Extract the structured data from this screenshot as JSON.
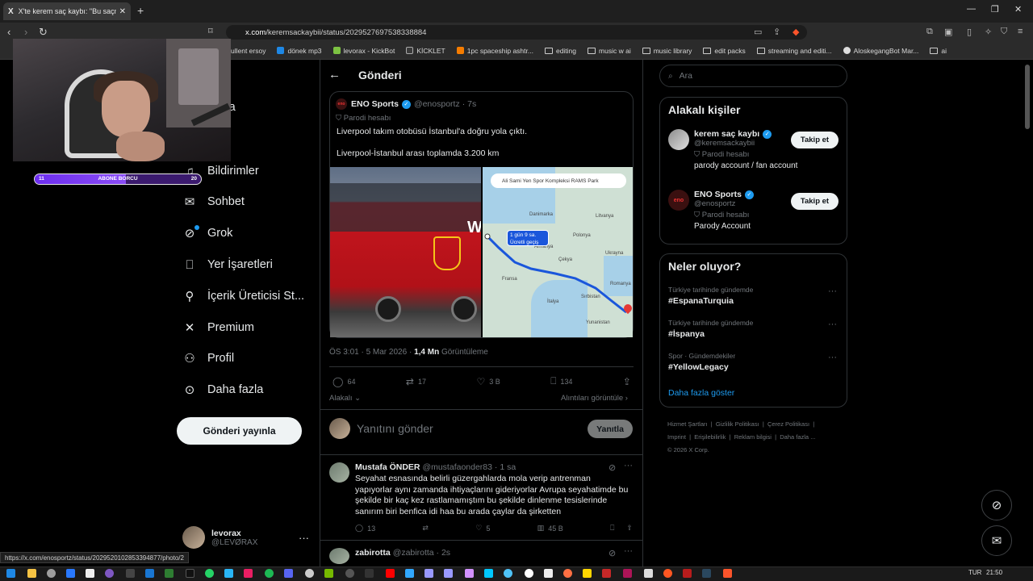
{
  "browser": {
    "tab_title": "X'te kerem saç kaybı: \"Bu saçmal",
    "tab_logo": "X",
    "url_host": "x.com",
    "url_path": "/keremsackaybii/status/2029527697538338884",
    "bookmarks": [
      {
        "label": "ullent ersoy",
        "type": "site"
      },
      {
        "label": "dönek mp3",
        "type": "site"
      },
      {
        "label": "levorax - KickBot",
        "type": "site"
      },
      {
        "label": "KİCKLET",
        "type": "site"
      },
      {
        "label": "1pc spaceship ashtr...",
        "type": "site"
      },
      {
        "label": "editing",
        "type": "folder"
      },
      {
        "label": "music w ai",
        "type": "folder"
      },
      {
        "label": "music library",
        "type": "folder"
      },
      {
        "label": "edit packs",
        "type": "folder"
      },
      {
        "label": "streaming and editi...",
        "type": "folder"
      },
      {
        "label": "AloskegangBot Mar...",
        "type": "site"
      },
      {
        "label": "ai",
        "type": "folder"
      }
    ],
    "status_url": "https://x.com/enosportz/status/2029520102853394877/photo/2"
  },
  "overlay": {
    "sub_label": "ABONE BORCU",
    "sub_current": "11",
    "sub_goal": "20",
    "sub_progress": 0.55
  },
  "nav": {
    "items": [
      {
        "label": "Anasayfa",
        "icon": "home-icon",
        "visible_label": "sayfa"
      },
      {
        "label": "Keşfet",
        "icon": "search-icon",
        "visible_label": "et"
      },
      {
        "label": "Bildirimler",
        "icon": "bell-icon"
      },
      {
        "label": "Sohbet",
        "icon": "chat-icon"
      },
      {
        "label": "Grok",
        "icon": "grok-icon"
      },
      {
        "label": "Yer İşaretleri",
        "icon": "bookmark-icon"
      },
      {
        "label": "İçerik Üreticisi St...",
        "icon": "creator-icon"
      },
      {
        "label": "Premium",
        "icon": "x-premium-icon"
      },
      {
        "label": "Profil",
        "icon": "person-icon"
      },
      {
        "label": "Daha fazla",
        "icon": "more-icon"
      }
    ],
    "post_button": "Gönderi yayınla",
    "account": {
      "name": "levorax",
      "handle": "@LEVØRAX"
    }
  },
  "post": {
    "header_title": "Gönderi",
    "quoted": {
      "name": "ENO Sports",
      "handle": "@enosportz",
      "time": "· 7s",
      "parody_label": "Parodi hesabı",
      "text1": "Liverpool takım otobüsü İstanbul'a doğru yola çıktı.",
      "text2": "Liverpool-İstanbul arası toplamda 3.200 km",
      "map": {
        "search": "Ali Sami Yen Spor Kompleksi RAMS Park",
        "route_label": "1 gün 9 sa.",
        "route_sub": "Ücretli geçiş",
        "labels": [
          "Danimarka",
          "Litvanya",
          "Almanya",
          "Polonya",
          "Fransa",
          "Çekya",
          "Ukrayna",
          "İtalya",
          "Romanya",
          "Sırbistan",
          "Yunanistan"
        ]
      },
      "bus_word": "We"
    },
    "meta_time": "ÖS 3:01 · 5 Mar 2026 · ",
    "meta_views": "1,4 Mn",
    "meta_views_label": " Görüntüleme",
    "stats": {
      "replies": "64",
      "reposts": "17",
      "likes": "3 B",
      "bookmarks": "134"
    },
    "sort_label": "Alakalı",
    "quotes_label": "Alıntıları görüntüle",
    "reply_placeholder": "Yanıtını gönder",
    "reply_button": "Yanıtla"
  },
  "replies": [
    {
      "name": "Mustafa ÖNDER",
      "handle": "@mustafaonder83",
      "time": "· 1 sa",
      "text": "Seyahat esnasında belirli güzergahlarda mola verip antrenman yapıyorlar aynı zamanda ihtiyaçlarını gideriyorlar Avrupa seyahatimde bu şekilde bir kaç kez rastlamamıştım bu şekilde dinlenme tesislerinde sanırım biri benfica idi haa bu arada çaylar da şirketten",
      "replies": "13",
      "likes": "5",
      "views": "45 B"
    },
    {
      "name": "zabirotta",
      "handle": "@zabirotta",
      "time": "· 2s"
    }
  ],
  "sidebar": {
    "search_placeholder": "Ara",
    "people_title": "Alakalı kişiler",
    "people": [
      {
        "name": "kerem saç kaybı",
        "handle": "@keremsackaybii",
        "parody": "Parodi hesabı",
        "bio": "parody account / fan account",
        "follow": "Takip et"
      },
      {
        "name": "ENO Sports",
        "handle": "@enosportz",
        "parody": "Parodi hesabı",
        "bio": "Parody Account",
        "follow": "Takip et"
      }
    ],
    "trends_title": "Neler oluyor?",
    "trends": [
      {
        "context": "Türkiye tarihinde gündemde",
        "tag": "#EspanaTurquia"
      },
      {
        "context": "Türkiye tarihinde gündemde",
        "tag": "#İspanya"
      },
      {
        "context": "Spor · Gündemdekiler",
        "tag": "#YellowLegacy"
      }
    ],
    "show_more": "Daha fazla göster",
    "footer_links": [
      "Hizmet Şartları",
      "Gizlilik Politikası",
      "Çerez Politikası",
      "Imprint",
      "Erişilebilirlik",
      "Reklam bilgisi",
      "Daha fazla ..."
    ],
    "copyright": "© 2026 X Corp."
  },
  "taskbar": {
    "lang": "TUR",
    "time": "21:50"
  },
  "colors": {
    "accent": "#1d9bf0",
    "background": "#000000",
    "border": "#2f3336",
    "muted": "#71767b",
    "bus_red": "#c8161f"
  }
}
